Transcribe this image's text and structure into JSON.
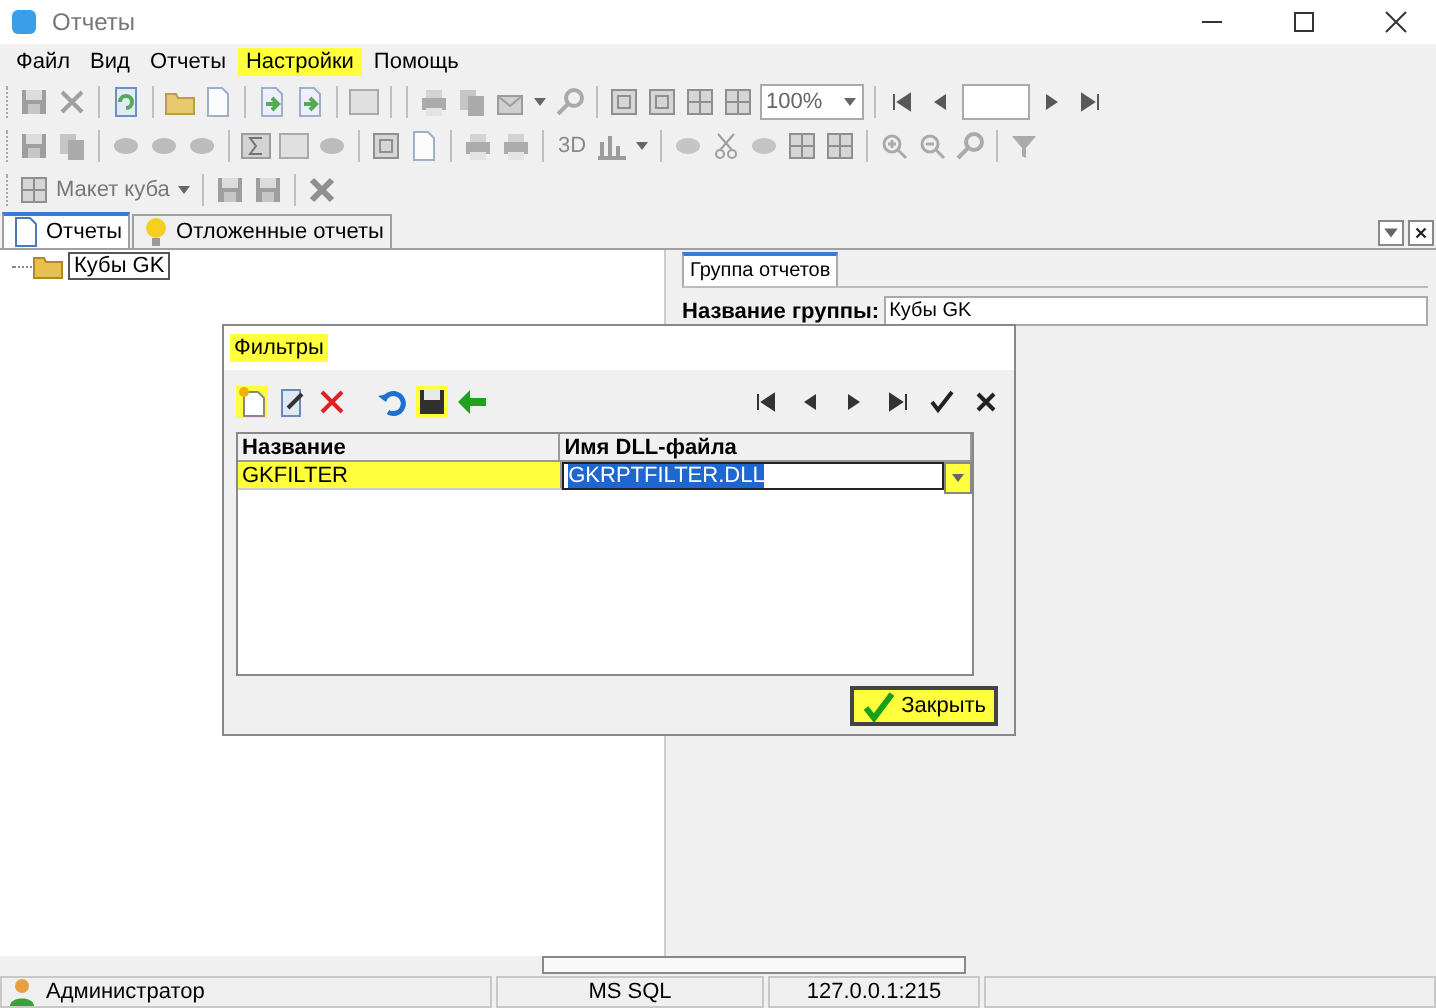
{
  "window": {
    "title": "Отчеты"
  },
  "menu": [
    {
      "label": "Файл",
      "highlighted": false
    },
    {
      "label": "Вид",
      "highlighted": false
    },
    {
      "label": "Отчеты",
      "highlighted": false
    },
    {
      "label": "Настройки",
      "highlighted": true
    },
    {
      "label": "Помощь",
      "highlighted": false
    }
  ],
  "toolbar": {
    "zoom": "100%",
    "label_3d": "3D",
    "cube_layout": "Макет куба"
  },
  "tabs": [
    {
      "label": "Отчеты",
      "selected": true
    },
    {
      "label": "Отложенные отчеты",
      "selected": false
    }
  ],
  "tree": [
    {
      "label": "Кубы GK",
      "selected": true
    }
  ],
  "details": {
    "tabs": [
      {
        "label": "Группа отчетов",
        "selected": true
      }
    ],
    "field_label": "Название группы:",
    "field_value": "Кубы GK"
  },
  "dialog": {
    "title": "Фильтры",
    "title_highlighted": true,
    "tools": [
      {
        "kind": "new",
        "highlighted": true
      },
      {
        "kind": "edit",
        "highlighted": false
      },
      {
        "kind": "delete",
        "highlighted": false
      },
      {
        "kind": "undo",
        "highlighted": false
      },
      {
        "kind": "save",
        "highlighted": true
      },
      {
        "kind": "back",
        "highlighted": false
      }
    ],
    "columns": [
      "Название",
      "Имя DLL-файла"
    ],
    "rows": [
      {
        "cells": [
          "GKFILTER",
          "GKRPTFILTER.DLL"
        ],
        "highlighted": true,
        "editing": true
      }
    ],
    "close_button": {
      "label": "Закрыть",
      "highlighted": true
    }
  },
  "status_bar": {
    "user": "Администратор",
    "server": "MS SQL",
    "address": "127.0.0.1:215"
  }
}
